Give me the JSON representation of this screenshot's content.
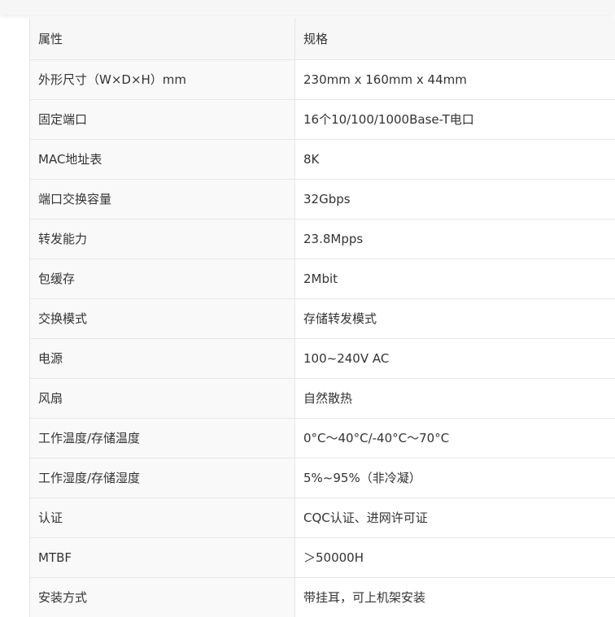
{
  "table": {
    "headers": [
      "属性",
      "规格"
    ],
    "rows": [
      [
        "外形尺寸（W×D×H）mm",
        "230mm x 160mm x 44mm"
      ],
      [
        "固定端口",
        "16个10/100/1000Base-T电口"
      ],
      [
        "MAC地址表",
        "8K"
      ],
      [
        "端口交换容量",
        "32Gbps"
      ],
      [
        "转发能力",
        "23.8Mpps"
      ],
      [
        "包缓存",
        "2Mbit"
      ],
      [
        "交换模式",
        "存储转发模式"
      ],
      [
        "电源",
        "100~240V AC"
      ],
      [
        "风扇",
        "自然散热"
      ],
      [
        "工作温度/存储温度",
        "0°C～40°C/-40°C～70°C"
      ],
      [
        "工作湿度/存储湿度",
        "5%~95%（非冷凝）"
      ],
      [
        "认证",
        "CQC认证、进网许可证"
      ],
      [
        "MTBF",
        "＞50000H"
      ],
      [
        "安装方式",
        "带挂耳，可上机架安装"
      ]
    ]
  }
}
